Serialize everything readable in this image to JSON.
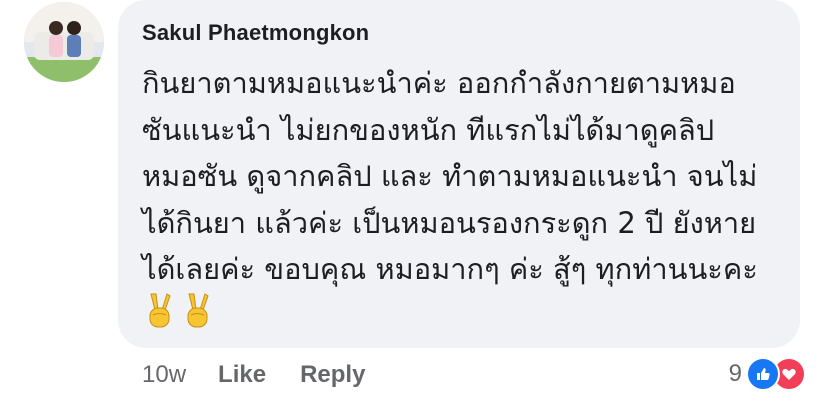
{
  "comment": {
    "author": "Sakul Phaetmongkon",
    "lines": [
      "กินยาตามหมอแนะนำค่ะ ออกกำลังกายตามหมอ",
      "ซันแนะนำ ไม่ยกของหนัก ทีแรกไม่ได้มาดูคลิป",
      "หมอซัน ดูจากคลิป และ ทำตามหมอแนะนำ จนไม่",
      "ได้กินยา แล้วค่ะ เป็นหมอนรองกระดูก 2 ปี ยังหาย",
      "ได้เลยค่ะ ขอบคุณ หมอมากๆ ค่ะ สู้ๆ ทุกท่านนะคะ"
    ],
    "emojis": [
      "victory-hand-emoji",
      "victory-hand-emoji"
    ]
  },
  "actions": {
    "timestamp": "10w",
    "like_label": "Like",
    "reply_label": "Reply"
  },
  "reactions": {
    "count": "9",
    "types": [
      "like-icon",
      "love-icon"
    ],
    "like_color": "#1877f2",
    "love_color": "#f33e58"
  },
  "colors": {
    "bubble": "#f0f2f5",
    "text": "#1c1e21",
    "secondary": "#65676b"
  }
}
